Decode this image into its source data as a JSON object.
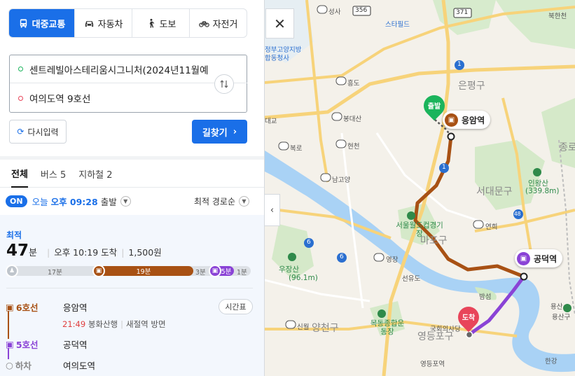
{
  "modes": [
    {
      "label": "대중교통",
      "icon": "bus-icon",
      "active": true
    },
    {
      "label": "자동차",
      "icon": "car-icon",
      "active": false
    },
    {
      "label": "도보",
      "icon": "walk-icon",
      "active": false
    },
    {
      "label": "자전거",
      "icon": "bicycle-icon",
      "active": false
    }
  ],
  "route": {
    "from": "센트레빌아스테리움시그니처(2024년11월예",
    "to": "여의도역 9호선",
    "swap_icon": "swap-icon"
  },
  "buttons": {
    "reset": "다시입력",
    "search": "길찾기"
  },
  "filter_tabs": [
    {
      "label": "전체",
      "active": true
    },
    {
      "label": "버스 5",
      "active": false
    },
    {
      "label": "지하철 2",
      "active": false
    }
  ],
  "departure": {
    "toggle": "ON",
    "day": "오늘",
    "time": "오후 09:28",
    "suffix": "출발",
    "sort": "최적 경로순"
  },
  "result": {
    "badge": "최적",
    "minutes": "47",
    "minutes_unit": "분",
    "arrival": "오후 10:19 도착",
    "fare": "1,500원",
    "timeline": {
      "walk1": "17분",
      "line6": "19분",
      "walk2": "3분",
      "line5": "5분",
      "walk3": "1분"
    },
    "steps": [
      {
        "line": "6호선",
        "station": "응암역"
      },
      {
        "line": "5호선",
        "station": "공덕역"
      },
      {
        "line": "하차",
        "station": "여의도역"
      }
    ],
    "board_time": "21:49",
    "board_direction": "봉화산행",
    "board_exit": "새절역 방면",
    "timetable": "시간표"
  },
  "map": {
    "start_pin": "출발",
    "end_pin": "도착",
    "station_labels": [
      {
        "name": "응암역",
        "line": "6",
        "color": "#a85114"
      },
      {
        "name": "공덕역",
        "line": "5",
        "color": "#8a43d6"
      }
    ],
    "districts": [
      "은평구",
      "서대문구",
      "마포구",
      "양천구",
      "영등포구",
      "종로"
    ],
    "places": [
      "스타필드",
      "정부고양지방합동청사",
      "서울월드컵경기장",
      "우장산",
      "인왕산",
      "목동종합운동장",
      "국회의사당",
      "선유도",
      "밤섬",
      "북한천",
      "용산구",
      "한강",
      "영등포역",
      "연희",
      "영장",
      "대교",
      "복로",
      "현천",
      "남고양",
      "봉대산",
      "성사",
      "흥도",
      "신월",
      "용산"
    ],
    "peaks": [
      "(96.1m)",
      "(339.8m)"
    ],
    "road_numbers": [
      "356",
      "371",
      "1",
      "6",
      "48"
    ],
    "colors": {
      "line6": "#a85114",
      "line5": "#8a43d6",
      "water": "#a9d2f5",
      "park": "#cfe8c4"
    }
  }
}
